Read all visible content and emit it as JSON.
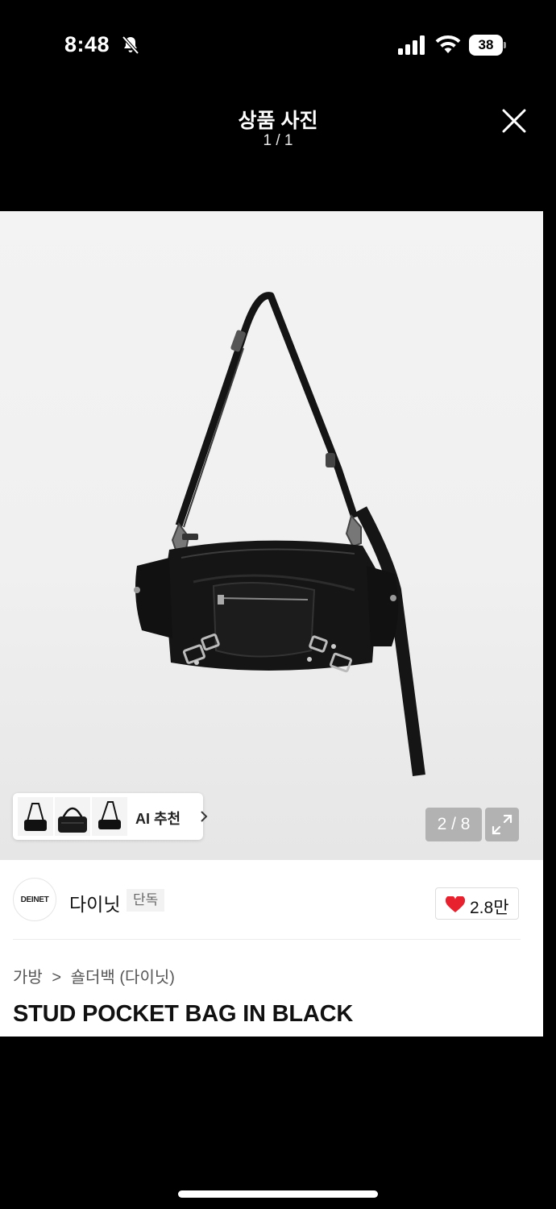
{
  "status_bar": {
    "time": "8:48",
    "battery": "38",
    "icons": [
      "bell-slash-icon",
      "cellular-signal-icon",
      "wifi-icon",
      "battery-icon"
    ]
  },
  "viewer": {
    "title": "상품 사진",
    "counter": "1 / 1",
    "close_icon": "close-icon"
  },
  "product_image": {
    "ai_recommend_label": "AI 추천",
    "ai_chevron_icon": "chevron-right-icon",
    "page_counter": "2 / 8",
    "expand_icon": "expand-icon"
  },
  "brand": {
    "logo_text": "DEINET",
    "name": "다이닛",
    "badge": "단독",
    "like_count": "2.8만",
    "like_icon": "heart-icon",
    "like_color": "#e8212e"
  },
  "breadcrumb": {
    "items": [
      "가방",
      "숄더백 (다이닛)"
    ],
    "separator": ">"
  },
  "product": {
    "title": "STUD POCKET BAG IN BLACK"
  }
}
